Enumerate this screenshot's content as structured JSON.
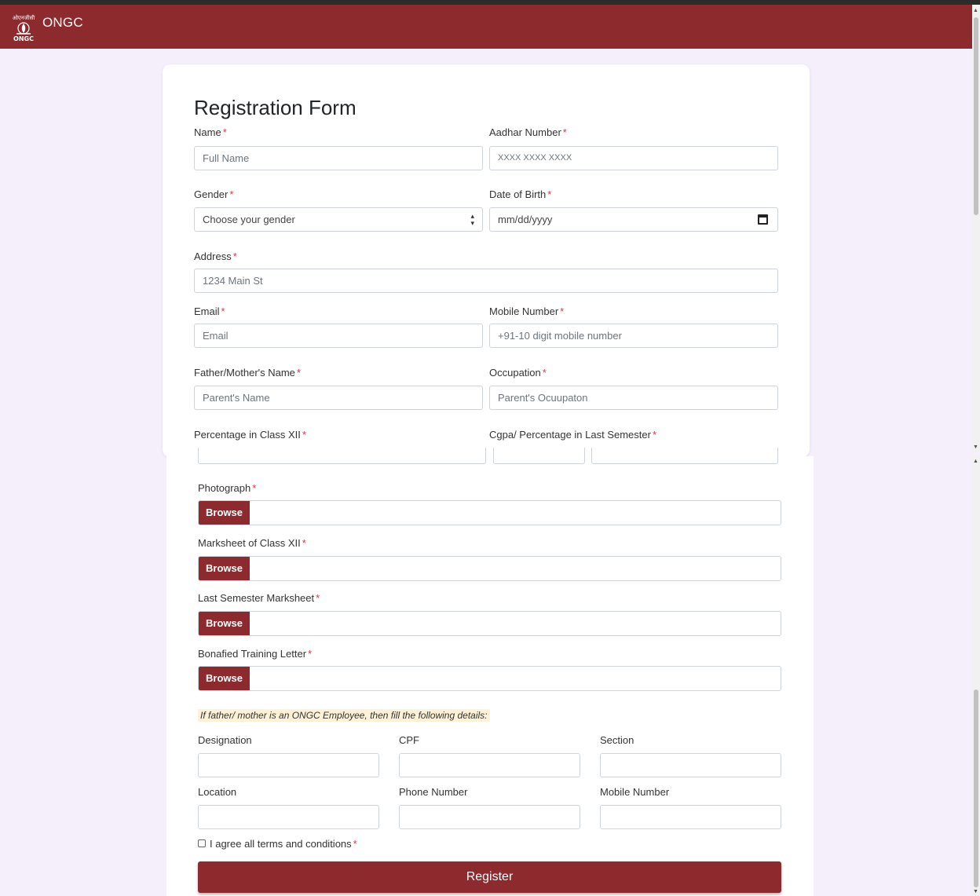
{
  "header": {
    "brand": "ONGC",
    "logo_text_top": "ओएनजीसी",
    "logo_text_bottom": "ONGC"
  },
  "form": {
    "title": "Registration Form",
    "name": {
      "label": "Name",
      "placeholder": "Full Name"
    },
    "aadhar": {
      "label": "Aadhar Number",
      "placeholder": "XXXX XXXX XXXX"
    },
    "gender": {
      "label": "Gender",
      "selected": "Choose your gender"
    },
    "dob": {
      "label": "Date of Birth",
      "placeholder": "mm/dd/yyyy"
    },
    "address": {
      "label": "Address",
      "placeholder": "1234 Main St"
    },
    "email": {
      "label": "Email",
      "placeholder": "Email"
    },
    "mobile": {
      "label": "Mobile Number",
      "placeholder": "+91-10 digit mobile number"
    },
    "parent_name": {
      "label": "Father/Mother's Name",
      "placeholder": "Parent's Name"
    },
    "occupation": {
      "label": "Occupation",
      "placeholder": "Parent's Ocuupaton"
    },
    "percentage_xii": {
      "label": "Percentage in Class XII"
    },
    "cgpa": {
      "label": "Cgpa/ Percentage in Last Semester"
    },
    "required_mark": "*",
    "uploads": [
      {
        "label": "Photograph",
        "button": "Browse"
      },
      {
        "label": "Marksheet of Class XII",
        "button": "Browse"
      },
      {
        "label": "Last Semester Marksheet",
        "button": "Browse"
      },
      {
        "label": "Bonafied Training Letter",
        "button": "Browse"
      }
    ],
    "employee_note": "If father/ mother is an ONGC Employee, then fill the following details:",
    "employee_fields": {
      "designation": "Designation",
      "cpf": "CPF",
      "section": "Section",
      "location": "Location",
      "phone": "Phone Number",
      "mobile": "Mobile Number"
    },
    "terms": "I agree all terms and conditions",
    "submit": "Register"
  },
  "colors": {
    "brand": "#8c2a2e",
    "background": "#f5effc",
    "required": "#dc3545",
    "note_bg": "#fdf2d6"
  },
  "icons": {
    "select": "up-down-caret-icon",
    "date": "calendar-icon",
    "logo": "ongc-flame-logo-icon"
  }
}
